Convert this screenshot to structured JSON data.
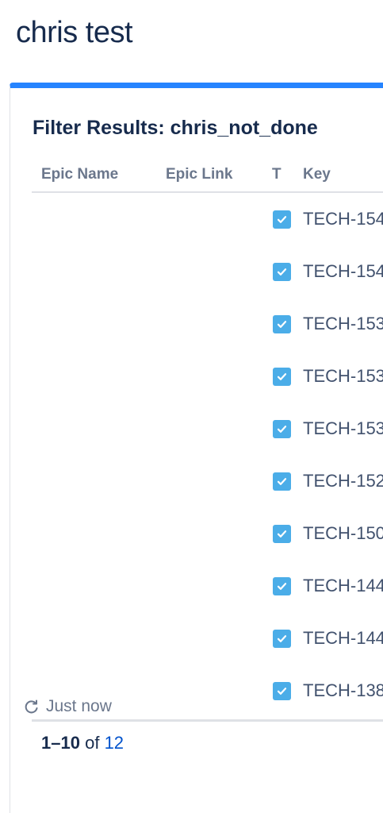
{
  "page": {
    "title": "chris test"
  },
  "gadget": {
    "title": "Filter Results: chris_not_done",
    "accent_color": "#2684ff",
    "columns": [
      "Epic Name",
      "Epic Link",
      "T",
      "Key"
    ],
    "rows": [
      {
        "type_icon": "story-checkbox-icon",
        "key": "TECH-154"
      },
      {
        "type_icon": "story-checkbox-icon",
        "key": "TECH-154"
      },
      {
        "type_icon": "story-checkbox-icon",
        "key": "TECH-153"
      },
      {
        "type_icon": "story-checkbox-icon",
        "key": "TECH-153"
      },
      {
        "type_icon": "story-checkbox-icon",
        "key": "TECH-153"
      },
      {
        "type_icon": "story-checkbox-icon",
        "key": "TECH-152"
      },
      {
        "type_icon": "story-checkbox-icon",
        "key": "TECH-150"
      },
      {
        "type_icon": "story-checkbox-icon",
        "key": "TECH-144"
      },
      {
        "type_icon": "story-checkbox-icon",
        "key": "TECH-144"
      },
      {
        "type_icon": "story-checkbox-icon",
        "key": "TECH-138"
      }
    ],
    "pagination": {
      "range": "1–10",
      "of_label": "of",
      "total": "12"
    },
    "refresh": {
      "icon": "refresh-icon",
      "label": "Just now"
    }
  }
}
